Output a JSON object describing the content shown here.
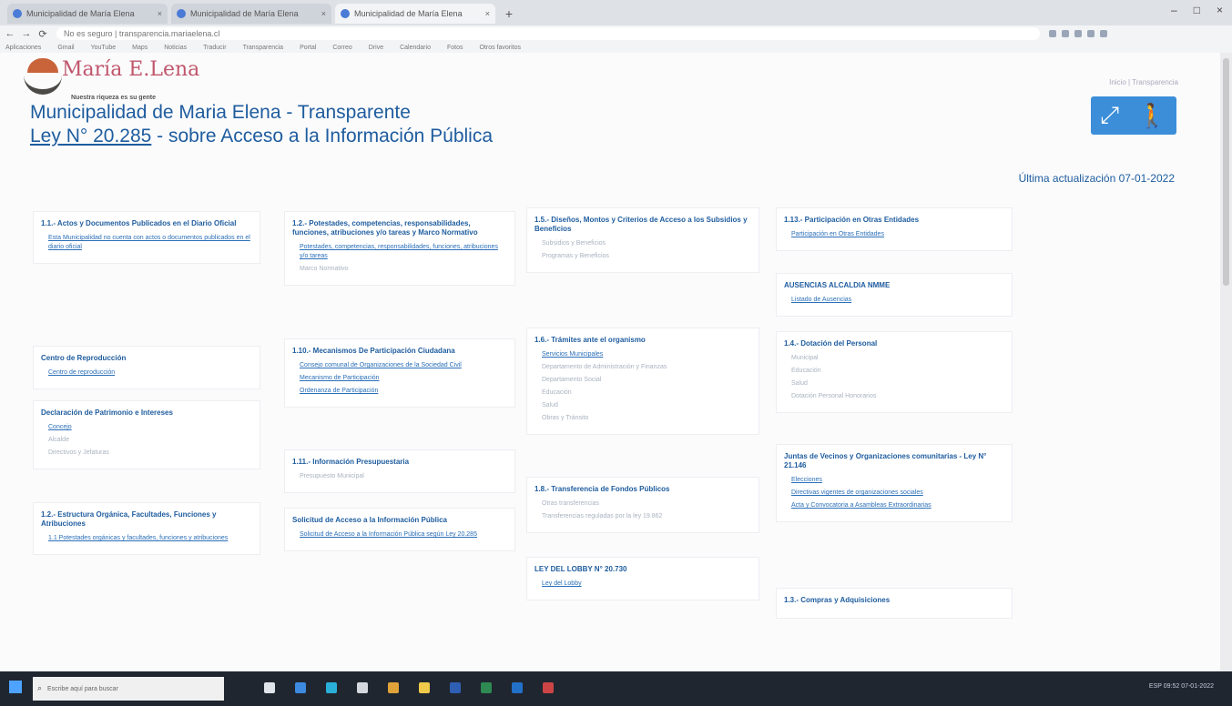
{
  "browser": {
    "tabs": [
      {
        "label": "Municipalidad de María Elena",
        "active": false
      },
      {
        "label": "Municipalidad de María Elena",
        "active": false
      },
      {
        "label": "Municipalidad de María Elena",
        "active": true
      }
    ],
    "new_tab": "+",
    "url": "No es seguro | transparencia.mariaelena.cl",
    "window_controls": [
      "–",
      "□",
      "×"
    ],
    "bookmarks": [
      "Aplicaciones",
      "Gmail",
      "YouTube",
      "Maps",
      "Noticias",
      "Traducir",
      "Transparencia",
      "Portal",
      "Correo",
      "Drive",
      "Calendario",
      "Fotos",
      "Otros favoritos"
    ]
  },
  "page": {
    "logo_text": "María E.Lena",
    "logo_tagline": "Nuestra riqueza es su gente",
    "top_links": "Inicio | Transparencia",
    "title_line1": "Municipalidad de Maria Elena - Transparente",
    "title_law": "Ley N° 20.285",
    "title_line2_rest": " - sobre Acceso a la Información Pública",
    "accessibility_icon": "accessibility-icon",
    "last_update": "Última actualización 07-01-2022",
    "columns": [
      [
        {
          "title": "1.1.- Actos y Documentos Publicados en el Diario Oficial",
          "links": [
            "Esta Municipalidad no cuenta con actos o documentos publicados en el diario oficial"
          ],
          "muted": []
        },
        {
          "title": "Centro de Reproducción",
          "links": [
            "Centro de reproducción"
          ],
          "muted": []
        },
        {
          "title": "Declaración de Patrimonio e Intereses",
          "links": [
            "Concejo"
          ],
          "muted": [
            "Alcalde",
            "Directivos y Jefaturas"
          ]
        },
        {
          "title": "1.2.- Estructura Orgánica, Facultades, Funciones y Atribuciones",
          "links": [
            "1.1 Potestades orgánicas y facultades, funciones y atribuciones"
          ],
          "muted": []
        }
      ],
      [
        {
          "title": "1.2.- Potestades, competencias, responsabilidades, funciones, atribuciones y/o tareas y Marco Normativo",
          "links": [
            "Potestades, competencias, responsabilidades, funciones, atribuciones y/o tareas"
          ],
          "muted": [
            "Marco Normativo"
          ]
        },
        {
          "title": "1.10.- Mecanismos De Participación Ciudadana",
          "links": [
            "Consejo comunal de Organizaciones de la Sociedad Civil",
            "Mecanismo de Participación",
            "Ordenanza de Participación"
          ],
          "muted": []
        },
        {
          "title": "1.11.- Información Presupuestaria",
          "links": [],
          "muted": [
            "Presupuesto Municipal"
          ]
        },
        {
          "title": "Solicitud de Acceso a la Información Pública",
          "links": [
            "Solicitud de Acceso a la Información Pública según Ley 20.285"
          ],
          "muted": []
        }
      ],
      [
        {
          "title": "1.5.- Diseños, Montos y Criterios de Acceso a los Subsidios y Beneficios",
          "links": [],
          "muted": [
            "Subsidios y Beneficios",
            "Programas y Beneficios"
          ]
        },
        {
          "title": "1.6.- Trámites ante el organismo",
          "links": [
            "Servicios Municipales"
          ],
          "muted": [
            "Departamento de Administración y Finanzas",
            "Departamento Social",
            "Educación",
            "Salud",
            "Obras y Tránsito"
          ]
        },
        {
          "title": "1.8.- Transferencia de Fondos Públicos",
          "links": [],
          "muted": [
            "Otras transferencias",
            "Transferencias reguladas por la ley 19.862"
          ]
        },
        {
          "title": "LEY DEL LOBBY N° 20.730",
          "links": [
            "Ley del Lobby"
          ],
          "muted": []
        }
      ],
      [
        {
          "title": "1.13.- Participación en Otras Entidades",
          "links": [
            "Participación en Otras Entidades"
          ],
          "muted": []
        },
        {
          "title": "AUSENCIAS ALCALDIA NMME",
          "links": [
            "Listado de Ausencias"
          ],
          "muted": []
        },
        {
          "title": "1.4.- Dotación del Personal",
          "links": [],
          "muted": [
            "Municipal",
            "Educación",
            "Salud",
            "Dotación Personal Honorarios"
          ]
        },
        {
          "title": "Juntas de Vecinos y Organizaciones comunitarias - Ley N° 21.146",
          "links": [
            "Elecciones",
            "Directivas vigentes de organizaciones sociales",
            "Acta y Convocatoria a Asambleas Extraordinarias"
          ],
          "muted": []
        },
        {
          "title": "1.3.- Compras y Adquisiciones",
          "links": [],
          "muted": []
        }
      ]
    ]
  },
  "taskbar": {
    "search_placeholder": "Escribe aquí para buscar",
    "tray_text": "ESP  09:52  07-01-2022"
  }
}
